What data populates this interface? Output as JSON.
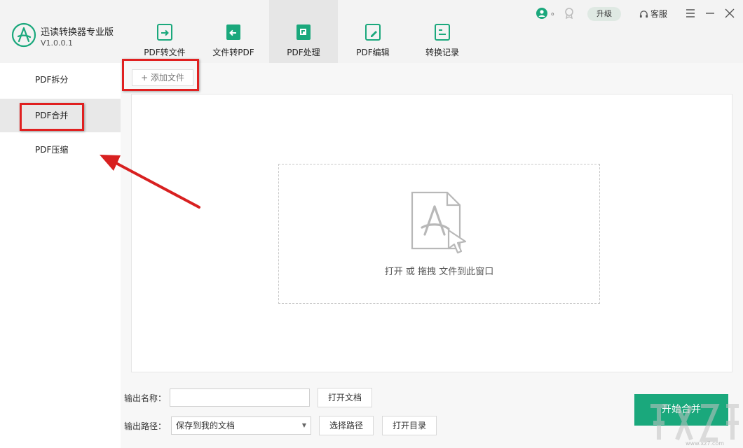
{
  "app": {
    "title": "迅读转换器专业版",
    "version": "V1.0.0.1"
  },
  "tabs": [
    {
      "label": "PDF转文件",
      "icon": "pdf-to-file-icon"
    },
    {
      "label": "文件转PDF",
      "icon": "file-to-pdf-icon"
    },
    {
      "label": "PDF处理",
      "icon": "pdf-process-icon",
      "active": true
    },
    {
      "label": "PDF编辑",
      "icon": "pdf-edit-icon"
    },
    {
      "label": "转换记录",
      "icon": "history-icon"
    }
  ],
  "topbar": {
    "user_dot": "。",
    "upgrade_label": "升级",
    "service_label": "客服"
  },
  "sidebar": {
    "items": [
      {
        "label": "PDF拆分"
      },
      {
        "label": "PDF合并",
        "active": true
      },
      {
        "label": "PDF压缩"
      }
    ]
  },
  "main": {
    "add_file_label": "+ 添加文件",
    "drop_text": "打开 或 拖拽 文件到此窗口",
    "output_name_label": "输出名称：",
    "output_name_value": "",
    "open_doc_label": "打开文档",
    "output_path_label": "输出路径：",
    "output_path_value": "保存到我的文档",
    "choose_path_label": "选择路径",
    "open_dir_label": "打开目录",
    "start_label": "开始合并"
  },
  "watermark": {
    "url": "www.xz7.com"
  },
  "colors": {
    "accent": "#1aa87c",
    "highlight_box": "#e02020",
    "header_bg": "#f3f3f3"
  }
}
